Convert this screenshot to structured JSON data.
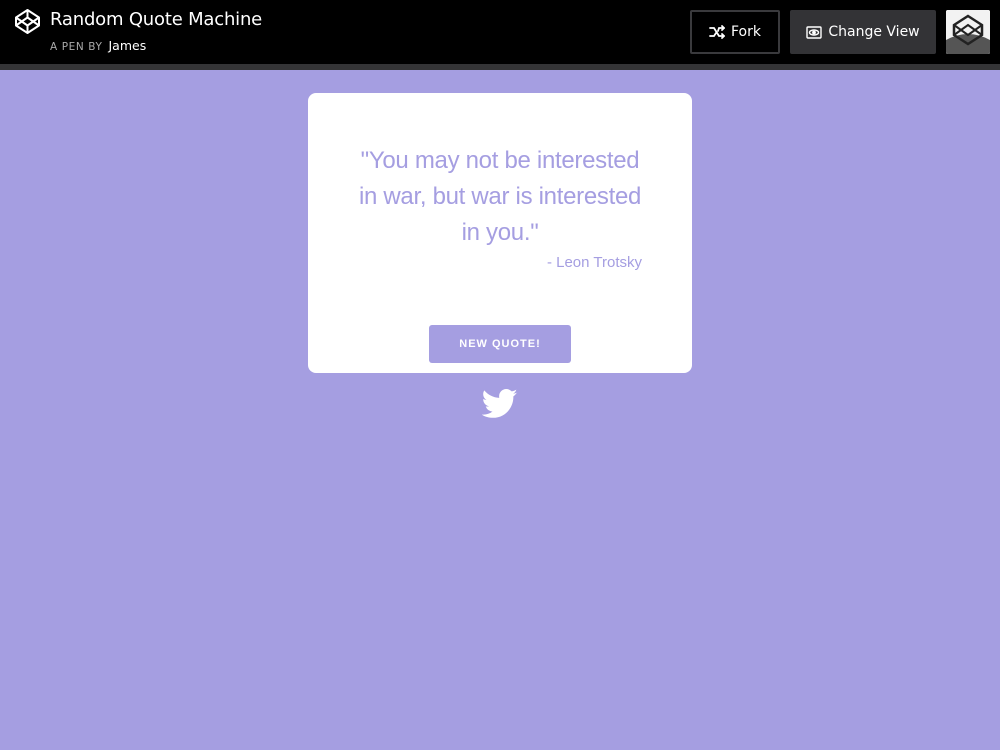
{
  "header": {
    "title": "Random Quote Machine",
    "byline_prefix": "A PEN BY",
    "author": "James",
    "fork_label": "Fork",
    "change_view_label": "Change View",
    "logo_icon": "codepen-logo-icon"
  },
  "quote": {
    "text": "\"You may not be interested in war, but war is interested in you.\"",
    "author": "- Leon Trotsky",
    "button_label": "NEW QUOTE!",
    "tweet_icon": "twitter-icon"
  },
  "colors": {
    "accent": "#a59ee1",
    "header_bg": "#000000",
    "card_bg": "#ffffff"
  }
}
